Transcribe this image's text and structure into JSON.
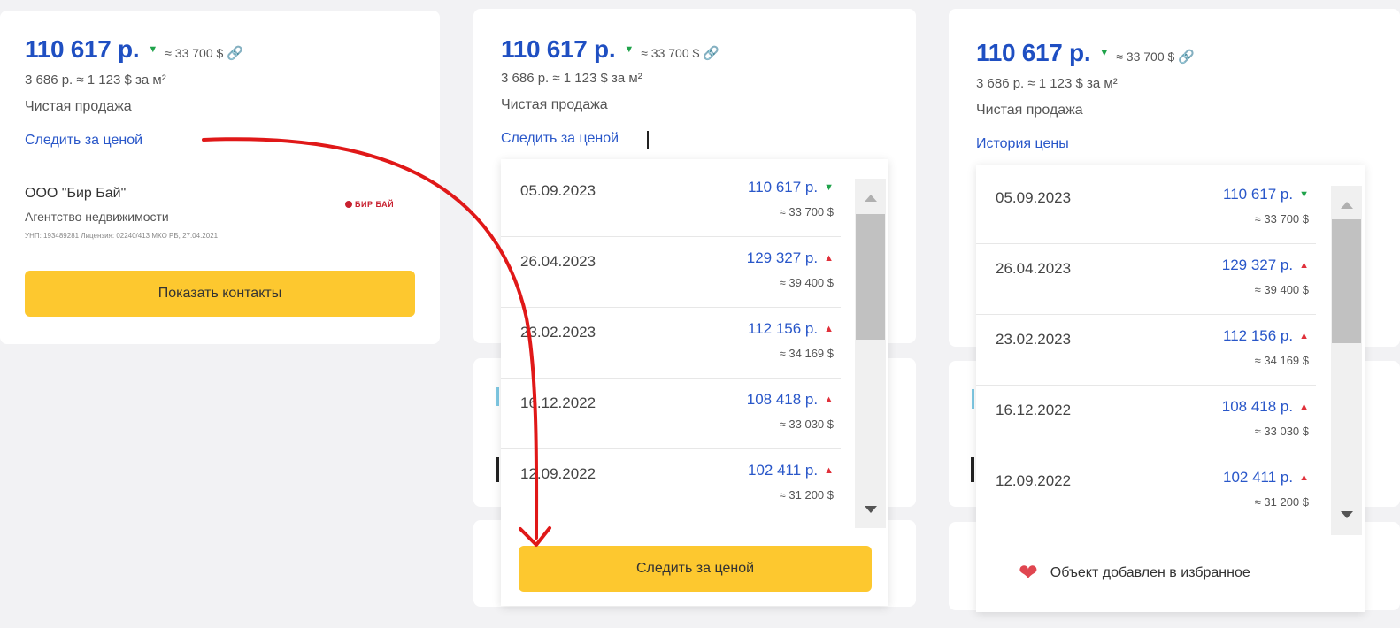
{
  "panel1": {
    "price": "110 617 р.",
    "usd": "≈ 33 700 $",
    "per_m2": "3 686 р. ≈ 1 123 $ за м²",
    "sale_type": "Чистая продажа",
    "watch_link": "Следить за ценой",
    "agency_name": "ООО \"Бир Бай\"",
    "agency_type": "Агентство недвижимости",
    "agency_legal": "УНП: 193489281 Лицензия: 02240/413 МКО РБ, 27.04.2021",
    "logo_text": "БИР БАЙ",
    "contacts_button": "Показать контакты"
  },
  "panel2": {
    "price": "110 617 р.",
    "usd": "≈ 33 700 $",
    "per_m2": "3 686 р. ≈ 1 123 $ за м²",
    "sale_type": "Чистая продажа",
    "watch_link": "Следить за ценой",
    "watch_button": "Следить за ценой"
  },
  "panel3": {
    "price": "110 617 р.",
    "usd": "≈ 33 700 $",
    "per_m2": "3 686 р. ≈ 1 123 $ за м²",
    "sale_type": "Чистая продажа",
    "history_link": "История цены",
    "favorite_notice": "Объект добавлен в избранное"
  },
  "history": [
    {
      "date": "05.09.2023",
      "rub": "110 617 р.",
      "usd": "≈ 33 700 $",
      "trend": "down"
    },
    {
      "date": "26.04.2023",
      "rub": "129 327 р.",
      "usd": "≈ 39 400 $",
      "trend": "up"
    },
    {
      "date": "23.02.2023",
      "rub": "112 156 р.",
      "usd": "≈ 34 169 $",
      "trend": "up"
    },
    {
      "date": "16.12.2022",
      "rub": "108 418 р.",
      "usd": "≈ 33 030 $",
      "trend": "up"
    },
    {
      "date": "12.09.2022",
      "rub": "102 411 р.",
      "usd": "≈ 31 200 $",
      "trend": "up"
    }
  ],
  "icons": {
    "trend_down": "triangle-down-icon",
    "trend_up": "triangle-up-icon",
    "link": "link-icon",
    "heart": "heart-icon"
  },
  "colors": {
    "price_blue": "#1f4fc2",
    "link_blue": "#2957c9",
    "button_yellow": "#fdc82f",
    "trend_down_green": "#1fa34a",
    "trend_up_red": "#e0303a",
    "arrow_red": "#e01818",
    "heart_red": "#e04650"
  }
}
